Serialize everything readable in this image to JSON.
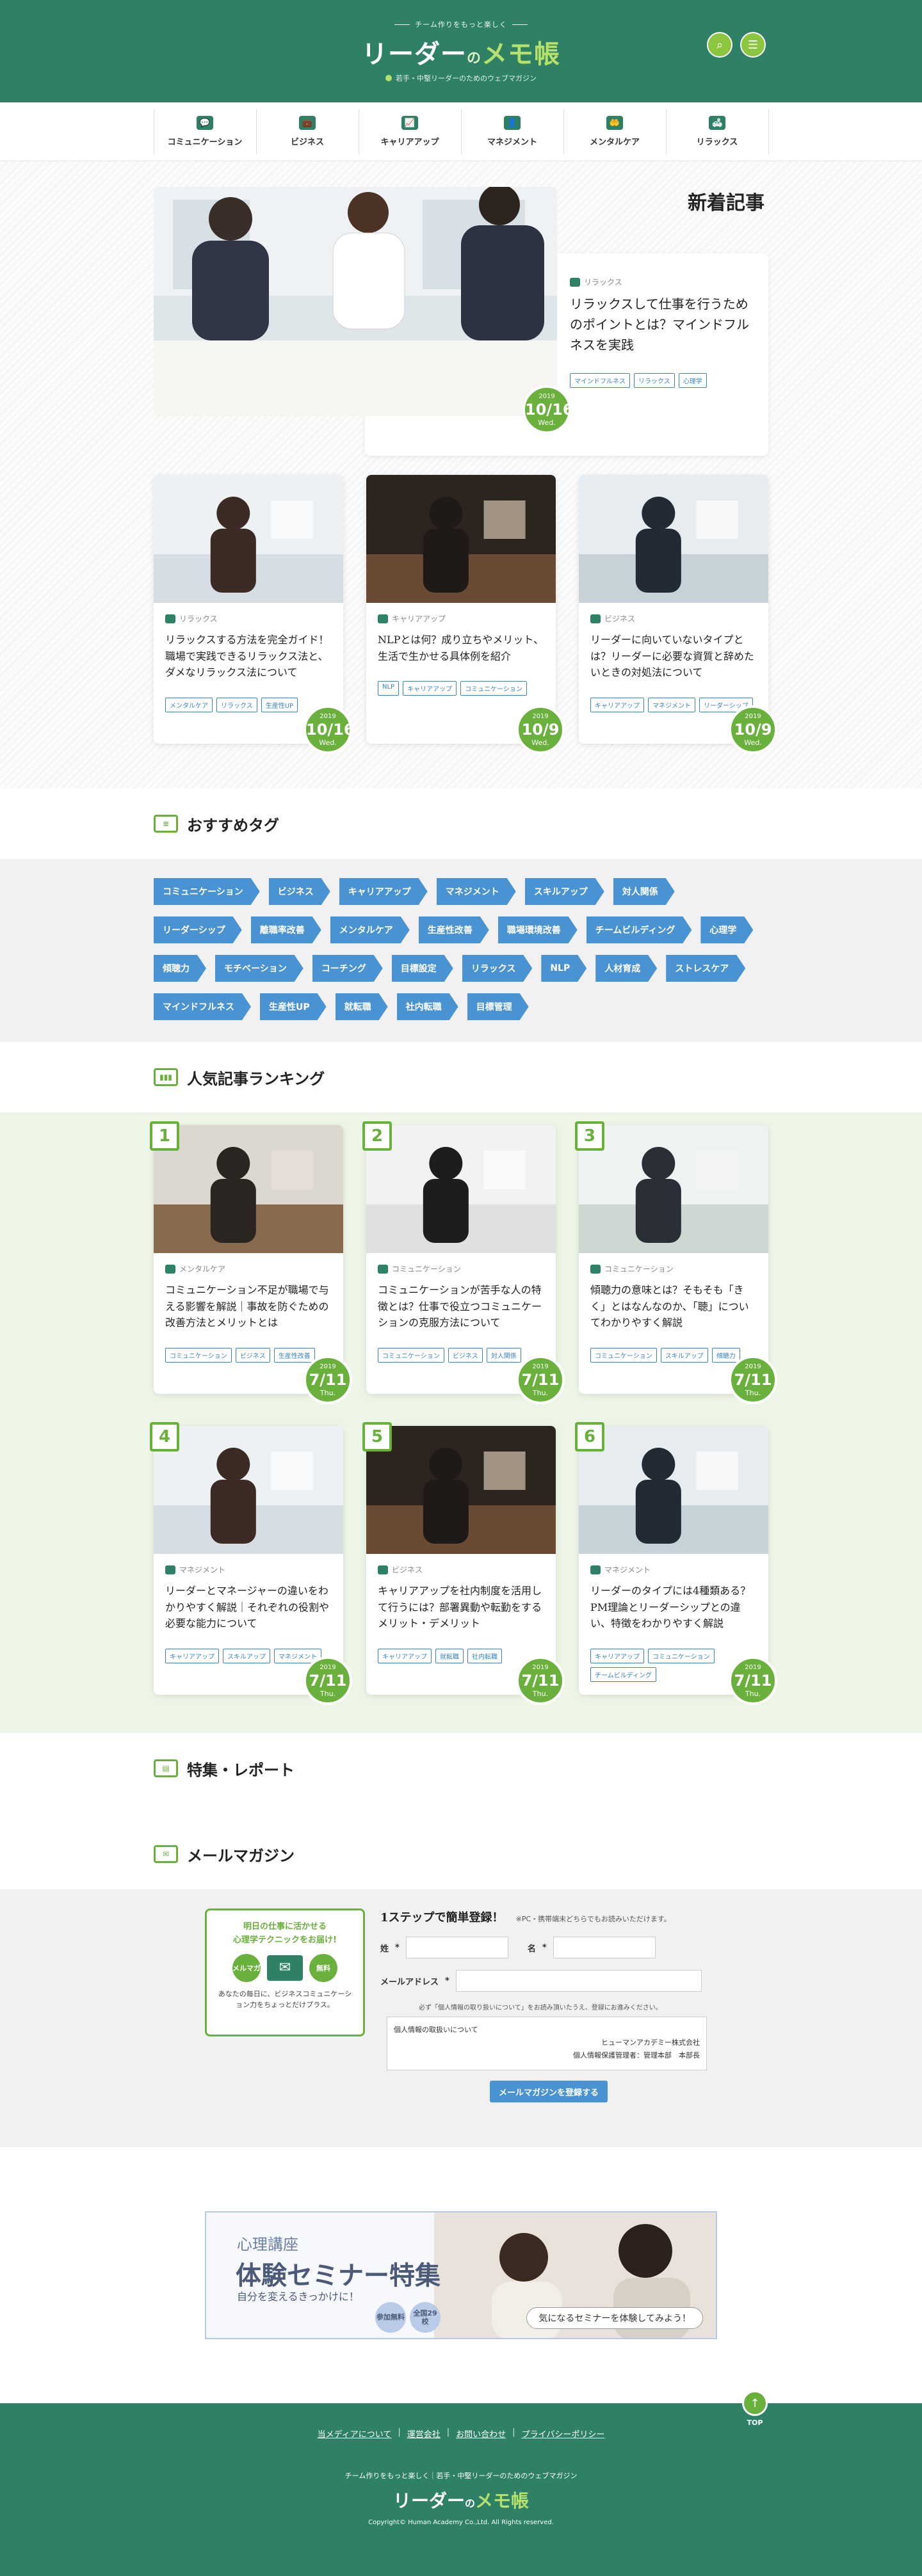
{
  "header": {
    "tagline": "チーム作りをもっと楽しく",
    "logo_main": "リーダー",
    "logo_no": "の",
    "logo_memo": "メモ帳",
    "logo_sub": "若手・中堅リーダーのためのウェブマガジン",
    "search_glyph": "⌕",
    "menu_glyph": "☰"
  },
  "nav": {
    "items": [
      {
        "label": "コミュニケーション",
        "icon": "chat-icon",
        "glyph": "💬"
      },
      {
        "label": "ビジネス",
        "icon": "briefcase-icon",
        "glyph": "💼"
      },
      {
        "label": "キャリアアップ",
        "icon": "stairs-icon",
        "glyph": "📈"
      },
      {
        "label": "マネジメント",
        "icon": "person-icon",
        "glyph": "👤"
      },
      {
        "label": "メンタルケア",
        "icon": "hands-icon",
        "glyph": "🤲"
      },
      {
        "label": "リラックス",
        "icon": "sofa-icon",
        "glyph": "🛋"
      }
    ]
  },
  "new_articles": {
    "heading": "新着記事",
    "feature": {
      "category": "リラックス",
      "title": "リラックスして仕事を行うためのポイントとは？マインドフルネスを実践",
      "tags": [
        "マインドフルネス",
        "リラックス",
        "心理学"
      ],
      "date": {
        "year": "2019",
        "day": "10/16",
        "weekday": "Wed."
      }
    },
    "cards": [
      {
        "category": "リラックス",
        "title": "リラックスする方法を完全ガイド！職場で実践できるリラックス法と、ダメなリラックス法について",
        "tags": [
          "メンタルケア",
          "リラックス",
          "生産性UP"
        ],
        "date": {
          "year": "2019",
          "day": "10/16",
          "weekday": "Wed."
        }
      },
      {
        "category": "キャリアアップ",
        "title": "NLPとは何？成り立ちやメリット、生活で生かせる具体例を紹介",
        "tags": [
          "NLP",
          "キャリアアップ",
          "コミュニケーション"
        ],
        "date": {
          "year": "2019",
          "day": "10/9",
          "weekday": "Wed."
        }
      },
      {
        "category": "ビジネス",
        "title": "リーダーに向いていないタイプとは？リーダーに必要な資質と辞めたいときの対処法について",
        "tags": [
          "キャリアアップ",
          "マネジメント",
          "リーダーシップ"
        ],
        "date": {
          "year": "2019",
          "day": "10/9",
          "weekday": "Wed."
        }
      }
    ]
  },
  "recommended_tags": {
    "heading": "おすすめタグ",
    "icon_text": "≡",
    "tags": [
      "コミュニケーション",
      "ビジネス",
      "キャリアアップ",
      "マネジメント",
      "スキルアップ",
      "対人関係",
      "リーダーシップ",
      "離職率改善",
      "メンタルケア",
      "生産性改善",
      "職場環境改善",
      "チームビルディング",
      "心理学",
      "傾聴力",
      "モチベーション",
      "コーチング",
      "目標設定",
      "リラックス",
      "NLP",
      "人材育成",
      "ストレスケア",
      "マインドフルネス",
      "生産性UP",
      "就転職",
      "社内転職",
      "目標管理"
    ]
  },
  "ranking": {
    "heading": "人気記事ランキング",
    "icon_text": "▮▮▮",
    "items": [
      {
        "rank": "1",
        "category": "メンタルケア",
        "title": "コミュニケーション不足が職場で与える影響を解説｜事故を防ぐための改善方法とメリットとは",
        "tags": [
          "コミュニケーション",
          "ビジネス",
          "生産性改善"
        ],
        "date": {
          "year": "2019",
          "day": "7/11",
          "weekday": "Thu."
        }
      },
      {
        "rank": "2",
        "category": "コミュニケーション",
        "title": "コミュニケーションが苦手な人の特徴とは？仕事で役立つコミュニケーションの克服方法について",
        "tags": [
          "コミュニケーション",
          "ビジネス",
          "対人関係"
        ],
        "date": {
          "year": "2019",
          "day": "7/11",
          "weekday": "Thu."
        }
      },
      {
        "rank": "3",
        "category": "コミュニケーション",
        "title": "傾聴力の意味とは？そもそも「きく」とはなんなのか、「聴」についてわかりやすく解説",
        "tags": [
          "コミュニケーション",
          "スキルアップ",
          "傾聴力"
        ],
        "date": {
          "year": "2019",
          "day": "7/11",
          "weekday": "Thu."
        }
      },
      {
        "rank": "4",
        "category": "マネジメント",
        "title": "リーダーとマネージャーの違いをわかりやすく解説｜それぞれの役割や必要な能力について",
        "tags": [
          "キャリアアップ",
          "スキルアップ",
          "マネジメント"
        ],
        "date": {
          "year": "2019",
          "day": "7/11",
          "weekday": "Thu."
        }
      },
      {
        "rank": "5",
        "category": "ビジネス",
        "title": "キャリアアップを社内制度を活用して行うには？部署異動や転勤をするメリット・デメリット",
        "tags": [
          "キャリアアップ",
          "就転職",
          "社内転職"
        ],
        "date": {
          "year": "2019",
          "day": "7/11",
          "weekday": "Thu."
        }
      },
      {
        "rank": "6",
        "category": "マネジメント",
        "title": "リーダーのタイプには4種類ある？PM理論とリーダーシップとの違い、特徴をわかりやすく解説",
        "tags": [
          "キャリアアップ",
          "コミュニケーション",
          "チームビルディング"
        ],
        "date": {
          "year": "2019",
          "day": "7/11",
          "weekday": "Thu."
        }
      }
    ]
  },
  "feature_report": {
    "heading": "特集・レポート",
    "icon_text": "▤"
  },
  "mail_magazine": {
    "heading": "メールマガジン",
    "icon_text": "✉",
    "promo_line1": "明日の仕事に活かせる",
    "promo_line2": "心理学テクニックをお届け!",
    "promo_badge1": "メルマガ",
    "promo_badge2": "無料",
    "promo_mail_glyph": "✉",
    "promo_desc": "あなたの毎日に、ビジネスコミュニケーション力をちょっとだけプラス。",
    "form_title": "1ステップで簡単登録！",
    "form_note": "※PC・携帯端末どちらでもお読みいただけます。",
    "last_name_label": "姓",
    "first_name_label": "名",
    "email_label": "メールアドレス",
    "required_mark": "*",
    "privacy_note": "必ず「個人情報の取り扱いについて」をお読み頂いたうえ、登録にお進みください。",
    "privacy_title": "個人情報の取扱いについて",
    "privacy_company": "ヒューマンアカデミー株式会社",
    "privacy_manager": "個人情報保護管理者：管理本部　本部長",
    "submit_label": "メールマガジンを登録する"
  },
  "banner": {
    "sub": "心理講座",
    "title": "体験セミナー特集",
    "desc": "自分を変えるきっかけに！",
    "badge1": "参加無料",
    "badge2": "全国29校",
    "cta": "気になるセミナーを体験してみよう！"
  },
  "footer": {
    "to_top": "TOP",
    "to_top_glyph": "↑",
    "links": [
      "当メディアについて",
      "運営会社",
      "お問い合わせ",
      "プライバシーポリシー"
    ],
    "separator": "|",
    "tagline": "チーム作りをもっと楽しく｜若手・中堅リーダーのためのウェブマガジン",
    "logo_main": "リーダー",
    "logo_no": "の",
    "logo_memo": "メモ帳",
    "copyright": "Copyright© Human Academy Co.,Ltd. All Rights reserved."
  },
  "colors": {
    "brand_green": "#2e8164",
    "accent_green": "#6ab03c",
    "tag_blue": "#4a93d2"
  }
}
